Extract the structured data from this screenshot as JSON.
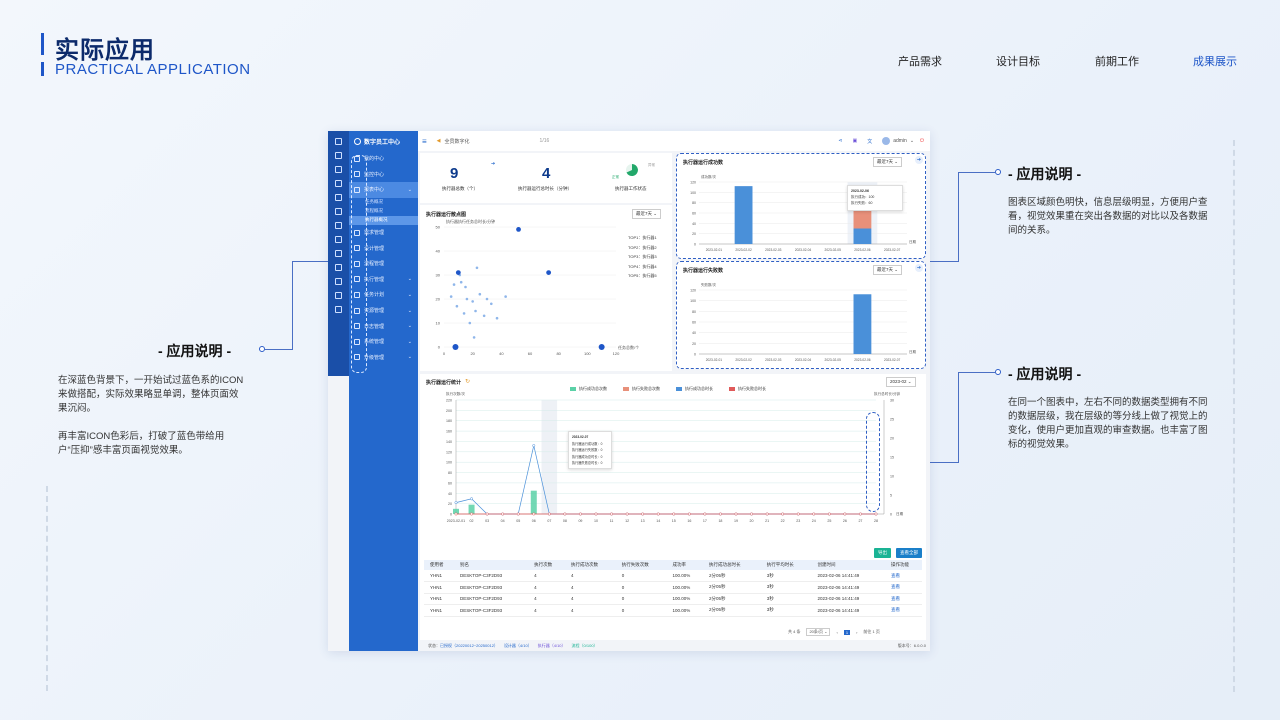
{
  "page": {
    "title": "实际应用",
    "subtitle": "PRACTICAL APPLICATION",
    "nav": [
      "产品需求",
      "设计目标",
      "前期工作",
      "成果展示"
    ]
  },
  "notes": {
    "left": {
      "title": "- 应用说明 -",
      "p1": "在深蓝色背景下，一开始试过蓝色系的ICON来做搭配，实际效果略显单调，整体页面效果沉闷。",
      "p2": "再丰富ICON色彩后，打破了蓝色带给用户“压抑”感丰富页面视觉效果。"
    },
    "right1": {
      "title": "- 应用说明 -",
      "p": "图表区域颜色明快，信息层级明显，方便用户查看，视觉效果重在突出各数据的对比以及各数据间的关系。"
    },
    "right2": {
      "title": "- 应用说明 -",
      "p": "在同一个图表中，左右不同的数据类型拥有不同的数据层级，我在层级的等分线上做了视觉上的变化，使用户更加直观的审查数据。也丰富了图标的视觉效果。"
    }
  },
  "app": {
    "brand": "数字员工中心",
    "menu": [
      {
        "label": "我的中心",
        "caret": ""
      },
      {
        "label": "监控中心",
        "caret": ""
      },
      {
        "label": "报表中心",
        "caret": "⌄",
        "active": true
      }
    ],
    "submenu": [
      "任务概况",
      "流程概况",
      "执行器概况"
    ],
    "menu2": [
      {
        "label": "需求管理",
        "caret": ""
      },
      {
        "label": "设计管理",
        "caret": ""
      },
      {
        "label": "流程管理",
        "caret": ""
      },
      {
        "label": "执行管理",
        "caret": "⌄"
      },
      {
        "label": "任务计划",
        "caret": "⌄"
      },
      {
        "label": "资源管理",
        "caret": "⌄"
      },
      {
        "label": "日志管理",
        "caret": "⌄"
      },
      {
        "label": "系统管理",
        "caret": "⌄"
      },
      {
        "label": "升级管理",
        "caret": "⌄"
      }
    ],
    "header": {
      "notice": "全员数字化",
      "pager": "1/16",
      "user": "admin"
    },
    "kpis": [
      {
        "value": "9",
        "label": "执行器总数（个）"
      },
      {
        "value": "4",
        "label": "执行器运行总时长（分钟）"
      },
      {
        "label": "执行器工作状态",
        "legend1": "正常",
        "legend2": "异常"
      }
    ],
    "scatter": {
      "title": "执行器运行散点图",
      "range": "最近7天",
      "top": [
        "TOP1：执行器1",
        "TOP2：执行器2",
        "TOP3：执行器3",
        "TOP4：执行器4",
        "TOP5：执行器5"
      ]
    },
    "success": {
      "title": "执行器运行成功数",
      "range": "最近7天",
      "tip_date": "2023-02-06",
      "tip_rows": [
        "执行成功：100",
        "执行失败：60"
      ]
    },
    "fail": {
      "title": "执行器运行失败数",
      "range": "最近7天"
    },
    "stats": {
      "title": "执行器运行统计",
      "month": "2023-02",
      "tip_date": "2023-02-07",
      "tip_rows": [
        "执行器运行成功数：0",
        "执行器运行失败数：0",
        "执行器成功总时长：0",
        "执行器失败总时长：0"
      ]
    },
    "buttons": {
      "export": "导出",
      "view_all": "查看全部"
    },
    "table": {
      "headers": [
        "使用者",
        "别名",
        "执行次数",
        "执行成功次数",
        "执行失败次数",
        "成功率",
        "执行成功总时长",
        "执行平均时长",
        "创建时间",
        "操作功能"
      ],
      "rows": [
        [
          "YHN1",
          "DESKTOP-C3F2D93",
          "4",
          "4",
          "0",
          "100.00%",
          "2分05秒",
          "3秒",
          "2023-02-06 14:41:49",
          "查看"
        ],
        [
          "YHN1",
          "DESKTOP-C3F2D93",
          "4",
          "4",
          "0",
          "100.00%",
          "2分05秒",
          "3秒",
          "2023-02-06 14:41:49",
          "查看"
        ],
        [
          "YHN1",
          "DESKTOP-C3F2D93",
          "4",
          "4",
          "0",
          "100.00%",
          "2分05秒",
          "3秒",
          "2023-02-06 14:41:49",
          "查看"
        ],
        [
          "YHN1",
          "DESKTOP-C3F2D93",
          "4",
          "4",
          "0",
          "100.00%",
          "2分05秒",
          "3秒",
          "2023-02-06 14:41:49",
          "查看"
        ]
      ],
      "pager": {
        "total": "共 4 条",
        "size": "20条/页",
        "page": "1",
        "goto": "前往 1 页"
      }
    },
    "footer": {
      "status": "状态：",
      "items": [
        "已授权（20220012~20250012）",
        "设计器（4/10）",
        "执行器（4/10）",
        "流程（0/100）"
      ],
      "version": "版本号：6.0.0.0"
    }
  },
  "chart_data": [
    {
      "type": "scatter",
      "title": "执行器运行散点图",
      "ylabel": "执行器执行任务总时长/分钟",
      "xlabel": "任务总数/个",
      "xlim": [
        0,
        120
      ],
      "ylim": [
        0,
        50
      ],
      "xticks": [
        0,
        20,
        40,
        60,
        80,
        100,
        120
      ],
      "yticks": [
        0,
        10,
        20,
        30,
        40,
        50
      ],
      "points": [
        [
          5,
          21
        ],
        [
          7,
          26
        ],
        [
          9,
          17
        ],
        [
          11,
          30
        ],
        [
          12,
          27
        ],
        [
          14,
          14
        ],
        [
          15,
          25
        ],
        [
          16,
          20
        ],
        [
          18,
          10
        ],
        [
          20,
          19
        ],
        [
          21,
          4
        ],
        [
          22,
          15
        ],
        [
          23,
          33
        ],
        [
          25,
          22
        ],
        [
          28,
          13
        ],
        [
          30,
          20
        ],
        [
          33,
          18
        ],
        [
          37,
          12
        ],
        [
          43,
          21
        ]
      ],
      "highlight": [
        [
          10,
          31
        ],
        [
          52,
          49
        ],
        [
          73,
          31
        ],
        [
          8,
          0
        ],
        [
          110,
          0
        ]
      ]
    },
    {
      "type": "bar",
      "title": "执行器运行成功数",
      "ylabel": "成功数/次",
      "xlabel": "日期",
      "categories": [
        "2023-02-01",
        "2023-02-02",
        "2023-02-03",
        "2023-02-04",
        "2023-02-05",
        "2023-02-06",
        "2023-02-07"
      ],
      "series": [
        {
          "values": [
            0,
            112,
            0,
            0,
            0,
            30,
            0
          ]
        },
        {
          "values": [
            0,
            0,
            0,
            0,
            0,
            60,
            0
          ]
        }
      ],
      "ylim": [
        0,
        120
      ],
      "yticks": [
        0,
        20,
        40,
        60,
        80,
        100,
        120
      ]
    },
    {
      "type": "bar",
      "title": "执行器运行失败数",
      "ylabel": "失败数/次",
      "xlabel": "日期",
      "categories": [
        "2023-02-01",
        "2023-02-02",
        "2023-02-03",
        "2023-02-04",
        "2023-02-05",
        "2023-02-06",
        "2023-02-07"
      ],
      "series": [
        {
          "values": [
            0,
            0,
            0,
            0,
            0,
            112,
            0
          ]
        }
      ],
      "ylim": [
        0,
        120
      ],
      "yticks": [
        0,
        20,
        40,
        60,
        80,
        100,
        120
      ]
    },
    {
      "type": "bar",
      "title": "执行器运行统计",
      "ylabel": "执行次数/次",
      "y2label": "执行总时长/分钟",
      "xlabel": "日期",
      "categories": [
        "2023-02-01",
        "02",
        "03",
        "04",
        "05",
        "06",
        "07",
        "08",
        "09",
        "10",
        "11",
        "12",
        "13",
        "14",
        "15",
        "16",
        "17",
        "18",
        "19",
        "20",
        "21",
        "22",
        "23",
        "24",
        "25",
        "26",
        "27",
        "28"
      ],
      "series": [
        {
          "name": "执行成功总次数",
          "values": [
            10,
            18,
            0,
            0,
            0,
            45,
            0,
            0,
            0,
            0,
            0,
            0,
            0,
            0,
            0,
            0,
            0,
            0,
            0,
            0,
            0,
            0,
            0,
            0,
            0,
            0,
            0,
            0
          ]
        },
        {
          "name": "执行失败总次数",
          "values": [
            0,
            0,
            0,
            0,
            0,
            0,
            0,
            0,
            0,
            0,
            0,
            0,
            0,
            0,
            0,
            0,
            0,
            0,
            0,
            0,
            0,
            0,
            0,
            0,
            0,
            0,
            0,
            0
          ]
        },
        {
          "name": "执行成功总时长",
          "values": [
            3,
            4,
            0,
            0,
            0,
            18,
            0,
            0,
            0,
            0,
            0,
            0,
            0,
            0,
            0,
            0,
            0,
            0,
            0,
            0,
            0,
            0,
            0,
            0,
            0,
            0,
            0,
            0
          ]
        },
        {
          "name": "执行失败总时长",
          "values": [
            0,
            0,
            0,
            0,
            0,
            0,
            0,
            0,
            0,
            0,
            0,
            0,
            0,
            0,
            0,
            0,
            0,
            0,
            0,
            0,
            0,
            0,
            0,
            0,
            0,
            0,
            0,
            0
          ]
        }
      ],
      "ylim": [
        0,
        220
      ],
      "y2lim": [
        0,
        30
      ],
      "yticks": [
        0,
        20,
        40,
        60,
        80,
        100,
        120,
        140,
        160,
        180,
        200,
        220
      ],
      "y2ticks": [
        0,
        5,
        10,
        15,
        20,
        25,
        30
      ]
    }
  ]
}
